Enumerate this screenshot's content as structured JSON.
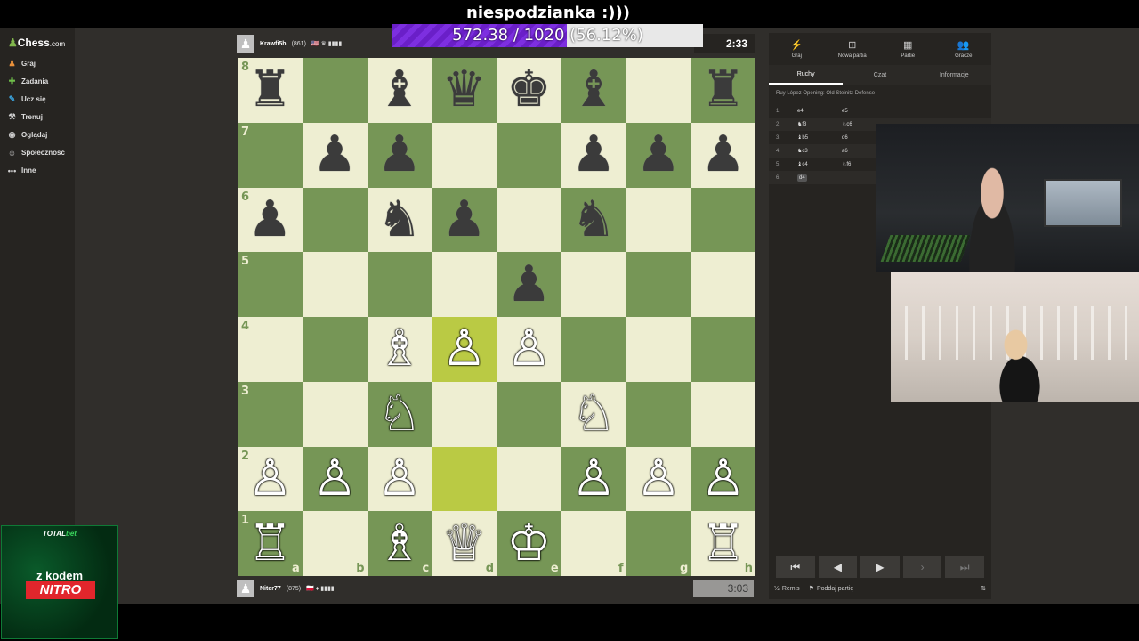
{
  "stream_goal": {
    "title": "niespodzianka :)))",
    "text": "572.38 / 1020 (56.12%)",
    "progress": 0.5612
  },
  "sidebar": {
    "logo_prefix": "Chess",
    "logo_suffix": ".com",
    "items": [
      {
        "label": "Graj",
        "icon": "pawn-icon"
      },
      {
        "label": "Zadania",
        "icon": "puzzle-icon"
      },
      {
        "label": "Ucz się",
        "icon": "learn-icon"
      },
      {
        "label": "Trenuj",
        "icon": "train-icon"
      },
      {
        "label": "Oglądaj",
        "icon": "watch-icon"
      },
      {
        "label": "Społeczność",
        "icon": "community-icon"
      },
      {
        "label": "Inne",
        "icon": "more-icon"
      }
    ]
  },
  "opponent": {
    "name": "Krawfi5h",
    "rating": "(861)",
    "flags": "🇺🇸 ♛ ▮▮▮▮"
  },
  "player": {
    "name": "Niter77",
    "rating": "(875)",
    "flags": "🇵🇱 ♦ ▮▮▮▮"
  },
  "clocks": {
    "top": "2:33",
    "bottom": "3:03"
  },
  "board": {
    "ranks": [
      "8",
      "7",
      "6",
      "5",
      "4",
      "3",
      "2",
      "1"
    ],
    "files": [
      "a",
      "b",
      "c",
      "d",
      "e",
      "f",
      "g",
      "h"
    ],
    "position": [
      [
        "bR",
        "",
        "bB",
        "bQ",
        "bK",
        "bB",
        "",
        "bR"
      ],
      [
        "",
        "bP",
        "bP",
        "",
        "",
        "bP",
        "bP",
        "bP"
      ],
      [
        "bP",
        "",
        "bN",
        "bP",
        "",
        "bN",
        "",
        ""
      ],
      [
        "",
        "",
        "",
        "",
        "bP",
        "",
        "",
        ""
      ],
      [
        "",
        "",
        "wB",
        "wP",
        "wP",
        "",
        "",
        ""
      ],
      [
        "",
        "",
        "wN",
        "",
        "",
        "wN",
        "",
        ""
      ],
      [
        "wP",
        "wP",
        "wP",
        "",
        "",
        "wP",
        "wP",
        "wP"
      ],
      [
        "wR",
        "",
        "wB",
        "wQ",
        "wK",
        "",
        "",
        "wR"
      ]
    ],
    "highlight": [
      "d4",
      "d2"
    ]
  },
  "panel": {
    "tabs": [
      {
        "label": "Graj",
        "icon": "bolt-icon"
      },
      {
        "label": "Nowa partia",
        "icon": "plus-icon"
      },
      {
        "label": "Partie",
        "icon": "board-icon"
      },
      {
        "label": "Gracze",
        "icon": "players-icon"
      }
    ],
    "subtabs": [
      "Ruchy",
      "Czat",
      "Informacje"
    ],
    "opening": "Ruy López Opening: Old Steinitz Defense",
    "moves": [
      {
        "num": "1.",
        "white": "e4",
        "black": "e5"
      },
      {
        "num": "2.",
        "white": "♞f3",
        "black": "♘c6"
      },
      {
        "num": "3.",
        "white": "♝b5",
        "black": "d6"
      },
      {
        "num": "4.",
        "white": "♞c3",
        "black": "a6"
      },
      {
        "num": "5.",
        "white": "♝c4",
        "black": "♘f6"
      },
      {
        "num": "6.",
        "white": "d4",
        "black": ""
      }
    ],
    "nav": [
      "⏮",
      "◀",
      "▶",
      "›",
      "⏭"
    ],
    "draw_label": "Remis",
    "draw_prefix": "½",
    "resign_label": "Poddaj partię"
  },
  "ad": {
    "brand_a": "TOTAL",
    "brand_b": "bet",
    "line": "z kodem",
    "code": "NITRO"
  }
}
